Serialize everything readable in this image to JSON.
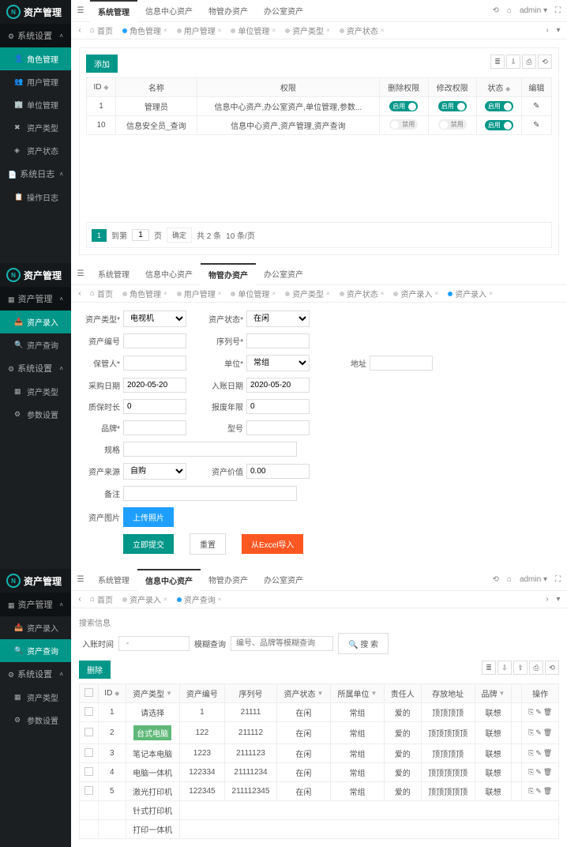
{
  "app_name": "资产管理",
  "topnav_right": {
    "admin": "admin",
    "chev": "▾"
  },
  "panel1": {
    "sidebar": {
      "groups": [
        {
          "label": "系统设置",
          "items": [
            "角色管理",
            "用户管理",
            "单位管理",
            "资产类型",
            "资产状态"
          ]
        },
        {
          "label": "系统日志",
          "items": [
            "操作日志"
          ]
        }
      ],
      "active_item": "角色管理"
    },
    "topnav": {
      "items": [
        "系统管理",
        "信息中心资产",
        "物管办资产",
        "办公室资产"
      ],
      "active": 0
    },
    "tabs": {
      "items": [
        "首页",
        "角色管理",
        "用户管理",
        "单位管理",
        "资产类型",
        "资产状态"
      ],
      "active": 1
    },
    "toolbar": {
      "add": "添加"
    },
    "table": {
      "headers": [
        "ID",
        "名称",
        "权限",
        "删除权限",
        "修改权限",
        "状态",
        "编辑"
      ],
      "rows": [
        {
          "id": "1",
          "name": "管理员",
          "perm": "信息中心资产,办公室资产,单位管理,参数...",
          "del": "启用",
          "mod": "启用",
          "status": "启用"
        },
        {
          "id": "10",
          "name": "信息安全员_查询",
          "perm": "信息中心资产,资产管理,资产查询",
          "del": "禁用",
          "mod": "禁用",
          "status": "启用"
        }
      ]
    },
    "pagination": {
      "to": "到第",
      "page_val": "1",
      "confirm": "确定",
      "total": "共 2 条",
      "per": "10 条/页"
    }
  },
  "panel2": {
    "sidebar": {
      "groups": [
        {
          "label": "资产管理",
          "items": [
            "资产录入",
            "资产查询"
          ]
        },
        {
          "label": "系统设置",
          "items": [
            "资产类型",
            "参数设置"
          ]
        }
      ],
      "active_item": "资产录入"
    },
    "topnav": {
      "items": [
        "系统管理",
        "信息中心资产",
        "物管办资产",
        "办公室资产"
      ],
      "active": 2
    },
    "tabs": {
      "items": [
        "首页",
        "角色管理",
        "用户管理",
        "单位管理",
        "资产类型",
        "资产状态",
        "资产录入",
        "资产录入"
      ],
      "active": 7
    },
    "form": {
      "asset_type_label": "资产类型*",
      "asset_type_val": "电视机",
      "asset_status_label": "资产状态*",
      "asset_status_val": "在闲",
      "asset_no_label": "资产编号",
      "serial_label": "序列号*",
      "keeper_label": "保管人*",
      "unit_label": "单位*",
      "unit_val": "常组",
      "address_label": "地址",
      "buy_date_label": "采购日期",
      "buy_date_val": "2020-05-20",
      "in_date_label": "入账日期",
      "in_date_val": "2020-05-20",
      "warranty_label": "质保时长",
      "warranty_val": "0",
      "scrap_label": "报废年限",
      "scrap_val": "0",
      "brand_label": "品牌*",
      "model_label": "型号",
      "spec_label": "规格",
      "source_label": "资产来源",
      "source_val": "自购",
      "value_label": "资产价值",
      "value_val": "0.00",
      "remark_label": "备注",
      "photo_label": "资产图片",
      "upload_btn": "上传照片",
      "submit_btn": "立即提交",
      "reset_btn": "重置",
      "import_btn": "从Excel导入"
    }
  },
  "panel3": {
    "sidebar": {
      "groups": [
        {
          "label": "资产管理",
          "items": [
            "资产录入",
            "资产查询"
          ]
        },
        {
          "label": "系统设置",
          "items": [
            "资产类型",
            "参数设置"
          ]
        }
      ],
      "active_item": "资产查询"
    },
    "topnav": {
      "items": [
        "系统管理",
        "信息中心资产",
        "物管办资产",
        "办公室资产"
      ],
      "active": 1
    },
    "tabs": {
      "items": [
        "首页",
        "资产录入",
        "资产查询"
      ],
      "active": 2
    },
    "search_title": "搜索信息",
    "search": {
      "in_time": "入账时间",
      "fuzzy": "模糊查询",
      "fuzzy_ph": "编号、品牌等模糊查询",
      "btn": "搜 索"
    },
    "del_btn": "删除",
    "table": {
      "headers": [
        "",
        "ID",
        "资产类型",
        "资产编号",
        "序列号",
        "资产状态",
        "所属单位",
        "责任人",
        "存放地址",
        "品牌",
        "",
        "操作"
      ],
      "rows": [
        {
          "id": "1",
          "type": "请选择",
          "no": "1",
          "serial": "21111",
          "status": "在闲",
          "unit": "常组",
          "resp": "爱的",
          "addr": "顶顶顶顶",
          "brand": "联想"
        },
        {
          "id": "2",
          "type": "台式电脑",
          "no": "122",
          "serial": "211112",
          "status": "在闲",
          "unit": "常组",
          "resp": "爱的",
          "addr": "顶顶顶顶顶",
          "brand": "联想"
        },
        {
          "id": "3",
          "type": "笔记本电脑",
          "no": "1223",
          "serial": "2111123",
          "status": "在闲",
          "unit": "常组",
          "resp": "爱的",
          "addr": "顶顶顶顶",
          "brand": "联想"
        },
        {
          "id": "4",
          "type": "电脑一体机",
          "no": "122334",
          "serial": "21111234",
          "status": "在闲",
          "unit": "常组",
          "resp": "爱的",
          "addr": "顶顶顶顶顶",
          "brand": "联想"
        },
        {
          "id": "5",
          "type": "激光打印机",
          "no": "122345",
          "serial": "211112345",
          "status": "在闲",
          "unit": "常组",
          "resp": "爱的",
          "addr": "顶顶顶顶顶",
          "brand": "联想"
        }
      ],
      "extra_types": [
        "针式打印机",
        "打印一体机"
      ]
    }
  }
}
